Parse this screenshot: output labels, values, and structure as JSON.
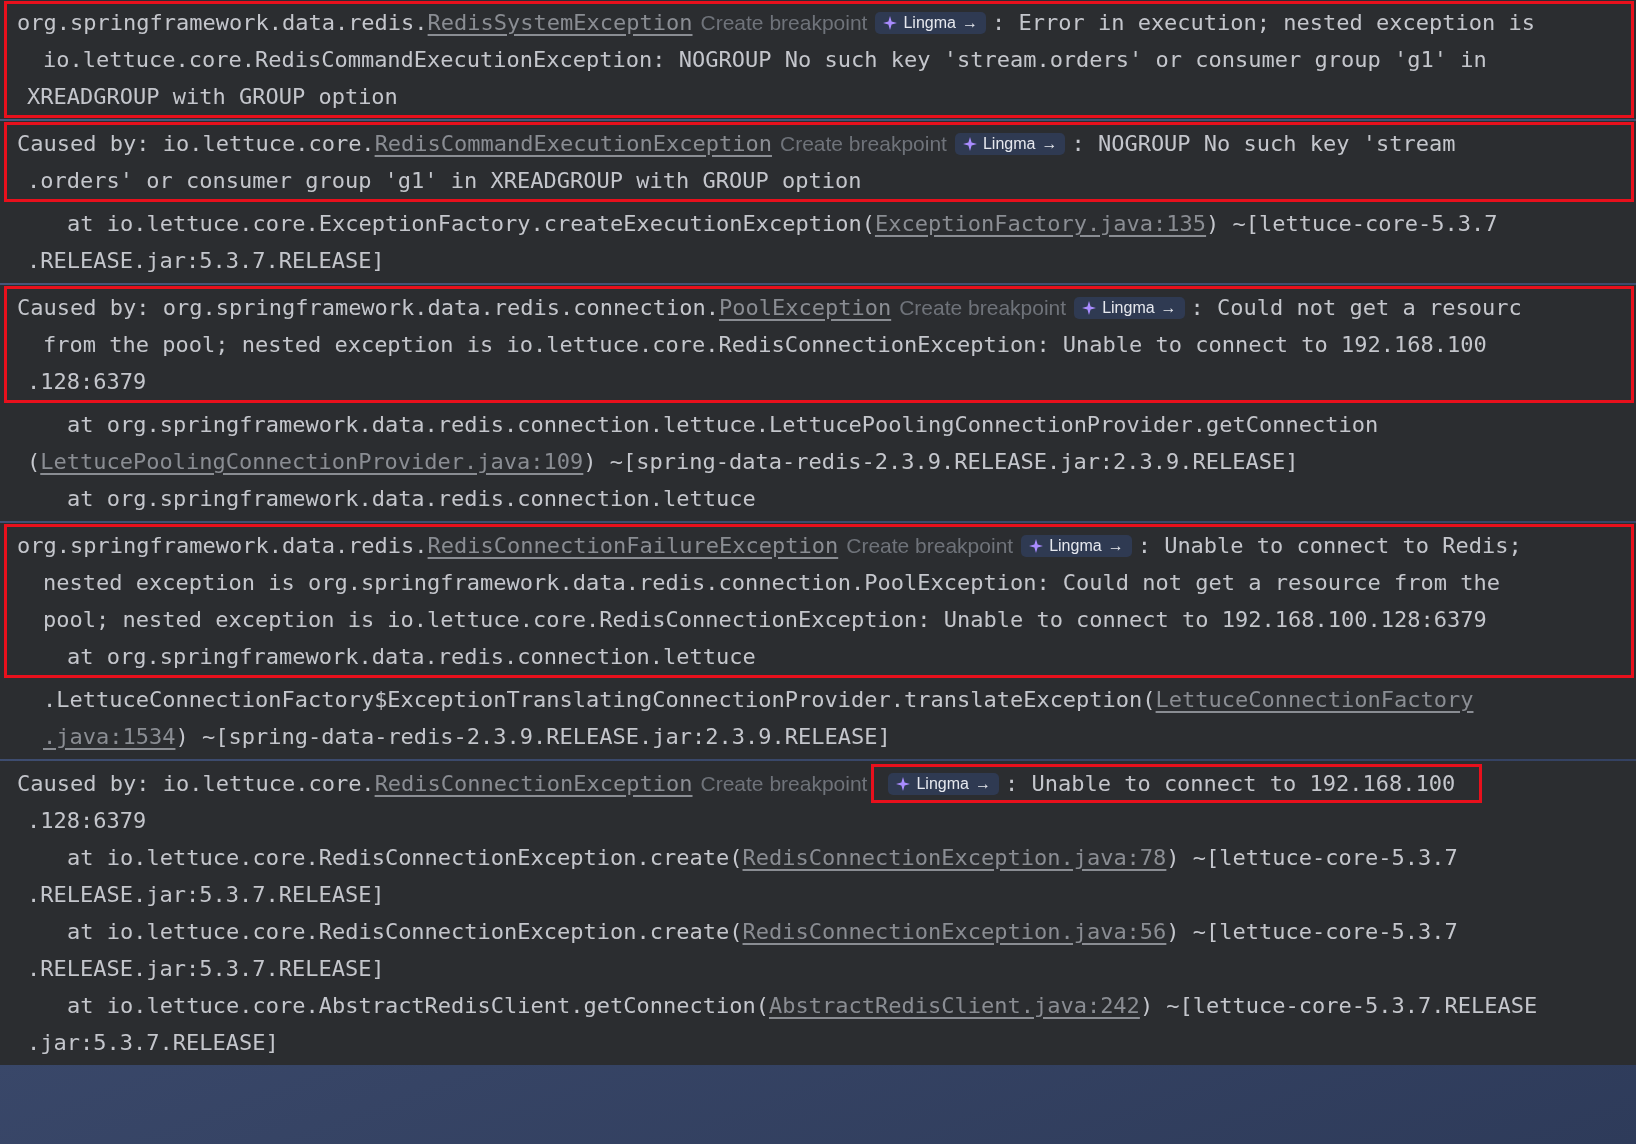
{
  "panels": [
    {
      "blocks": [
        {
          "highlighted": true,
          "lines": [
            {
              "kind": "head",
              "segments": [
                {
                  "kind": "text",
                  "text": "org.springframework.data.redis."
                },
                {
                  "kind": "link",
                  "text": "RedisSystemException"
                },
                {
                  "kind": "hint",
                  "text": "Create breakpoint"
                },
                {
                  "kind": "badge",
                  "text": "Lingma",
                  "arrow": "→"
                },
                {
                  "kind": "text",
                  "text": ": Error in execution; nested exception is"
                }
              ]
            },
            {
              "kind": "cont",
              "segments": [
                {
                  "kind": "text",
                  "text": "io.lettuce.core.RedisCommandExecutionException: NOGROUP No such key 'stream.orders' or consumer group 'g1' in"
                }
              ]
            },
            {
              "kind": "wrap",
              "segments": [
                {
                  "kind": "text",
                  "text": "XREADGROUP with GROUP option"
                }
              ]
            }
          ]
        }
      ]
    },
    {
      "blocks": [
        {
          "highlighted": true,
          "lines": [
            {
              "kind": "head",
              "segments": [
                {
                  "kind": "text",
                  "text": "Caused by: io.lettuce.core."
                },
                {
                  "kind": "link",
                  "text": "RedisCommandExecutionException"
                },
                {
                  "kind": "hint",
                  "text": "Create breakpoint"
                },
                {
                  "kind": "badge",
                  "text": "Lingma",
                  "arrow": "→"
                },
                {
                  "kind": "text",
                  "text": ": NOGROUP No such key 'stream"
                }
              ]
            },
            {
              "kind": "wrap",
              "segments": [
                {
                  "kind": "text",
                  "text": ".orders' or consumer group 'g1' in XREADGROUP with GROUP option"
                }
              ]
            }
          ]
        },
        {
          "highlighted": false,
          "lines": [
            {
              "kind": "frame",
              "segments": [
                {
                  "kind": "text",
                  "text": "at io.lettuce.core.ExceptionFactory.createExecutionException("
                },
                {
                  "kind": "link",
                  "text": "ExceptionFactory.java:135"
                },
                {
                  "kind": "text",
                  "text": ") ~[lettuce-core-5.3.7"
                }
              ]
            },
            {
              "kind": "wrap",
              "segments": [
                {
                  "kind": "text",
                  "text": ".RELEASE.jar:5.3.7.RELEASE]"
                }
              ]
            }
          ]
        }
      ]
    },
    {
      "blocks": [
        {
          "highlighted": true,
          "lines": [
            {
              "kind": "head",
              "segments": [
                {
                  "kind": "text",
                  "text": "Caused by: org.springframework.data.redis.connection."
                },
                {
                  "kind": "link",
                  "text": "PoolException"
                },
                {
                  "kind": "hint",
                  "text": "Create breakpoint"
                },
                {
                  "kind": "badge",
                  "text": "Lingma",
                  "arrow": "→"
                },
                {
                  "kind": "text",
                  "text": ": Could not get a resourc"
                }
              ]
            },
            {
              "kind": "cont",
              "segments": [
                {
                  "kind": "text",
                  "text": "from the pool; nested exception is io.lettuce.core.RedisConnectionException: Unable to connect to 192.168.100"
                }
              ]
            },
            {
              "kind": "wrap",
              "segments": [
                {
                  "kind": "text",
                  "text": ".128:6379"
                }
              ]
            }
          ]
        },
        {
          "highlighted": false,
          "lines": [
            {
              "kind": "frame",
              "segments": [
                {
                  "kind": "text",
                  "text": "at org.springframework.data.redis.connection.lettuce.LettucePoolingConnectionProvider.getConnection"
                }
              ]
            },
            {
              "kind": "wrap",
              "segments": [
                {
                  "kind": "text",
                  "text": "("
                },
                {
                  "kind": "link",
                  "text": "LettucePoolingConnectionProvider.java:109"
                },
                {
                  "kind": "text",
                  "text": ") ~[spring-data-redis-2.3.9.RELEASE.jar:2.3.9.RELEASE]"
                }
              ]
            },
            {
              "kind": "frame",
              "segments": [
                {
                  "kind": "text",
                  "text": "at org.springframework.data.redis.connection.lettuce"
                }
              ]
            }
          ]
        }
      ]
    },
    {
      "blocks": [
        {
          "highlighted": true,
          "lines": [
            {
              "kind": "head",
              "segments": [
                {
                  "kind": "text",
                  "text": "org.springframework.data.redis."
                },
                {
                  "kind": "link",
                  "text": "RedisConnectionFailureException"
                },
                {
                  "kind": "hint",
                  "text": "Create breakpoint"
                },
                {
                  "kind": "badge",
                  "text": "Lingma",
                  "arrow": "→"
                },
                {
                  "kind": "text",
                  "text": ": Unable to connect to Redis;"
                }
              ]
            },
            {
              "kind": "cont",
              "segments": [
                {
                  "kind": "text",
                  "text": "nested exception is org.springframework.data.redis.connection.PoolException: Could not get a resource from the"
                }
              ]
            },
            {
              "kind": "cont",
              "segments": [
                {
                  "kind": "text",
                  "text": "pool; nested exception is io.lettuce.core.RedisConnectionException: Unable to connect to 192.168.100.128:6379"
                }
              ]
            },
            {
              "kind": "frame",
              "segments": [
                {
                  "kind": "text",
                  "text": "at org.springframework.data.redis.connection.lettuce"
                }
              ]
            }
          ]
        },
        {
          "highlighted": false,
          "lines": [
            {
              "kind": "cont",
              "segments": [
                {
                  "kind": "text",
                  "text": ".LettuceConnectionFactory$ExceptionTranslatingConnectionProvider.translateException("
                },
                {
                  "kind": "link",
                  "text": "LettuceConnectionFactory"
                }
              ]
            },
            {
              "kind": "cont",
              "segments": [
                {
                  "kind": "link",
                  "text": ".java:1534"
                },
                {
                  "kind": "text",
                  "text": ") ~[spring-data-redis-2.3.9.RELEASE.jar:2.3.9.RELEASE]"
                }
              ]
            }
          ]
        }
      ]
    },
    {
      "blocks": [
        {
          "highlighted": false,
          "lines": [
            {
              "kind": "head",
              "segments": [
                {
                  "kind": "text",
                  "text": "Caused by: io.lettuce.core."
                },
                {
                  "kind": "link",
                  "text": "RedisConnectionException"
                },
                {
                  "kind": "hint",
                  "text": "Create breakpoint"
                },
                {
                  "kind": "box",
                  "segments": [
                    {
                      "kind": "badge",
                      "text": "Lingma",
                      "arrow": "→"
                    },
                    {
                      "kind": "text",
                      "text": ": Unable to connect to 192.168.100"
                    }
                  ]
                }
              ]
            },
            {
              "kind": "wrap",
              "segments": [
                {
                  "kind": "text",
                  "text": ".128:6379"
                }
              ]
            },
            {
              "kind": "frame",
              "segments": [
                {
                  "kind": "text",
                  "text": "at io.lettuce.core.RedisConnectionException.create("
                },
                {
                  "kind": "link",
                  "text": "RedisConnectionException.java:78"
                },
                {
                  "kind": "text",
                  "text": ") ~[lettuce-core-5.3.7"
                }
              ]
            },
            {
              "kind": "wrap",
              "segments": [
                {
                  "kind": "text",
                  "text": ".RELEASE.jar:5.3.7.RELEASE]"
                }
              ]
            },
            {
              "kind": "frame",
              "segments": [
                {
                  "kind": "text",
                  "text": "at io.lettuce.core.RedisConnectionException.create("
                },
                {
                  "kind": "link",
                  "text": "RedisConnectionException.java:56"
                },
                {
                  "kind": "text",
                  "text": ") ~[lettuce-core-5.3.7"
                }
              ]
            },
            {
              "kind": "wrap",
              "segments": [
                {
                  "kind": "text",
                  "text": ".RELEASE.jar:5.3.7.RELEASE]"
                }
              ]
            },
            {
              "kind": "frame",
              "segments": [
                {
                  "kind": "text",
                  "text": "at io.lettuce.core.AbstractRedisClient.getConnection("
                },
                {
                  "kind": "link",
                  "text": "AbstractRedisClient.java:242"
                },
                {
                  "kind": "text",
                  "text": ") ~[lettuce-core-5.3.7.RELEASE"
                }
              ]
            },
            {
              "kind": "wrap",
              "segments": [
                {
                  "kind": "text",
                  "text": ".jar:5.3.7.RELEASE]"
                }
              ]
            }
          ]
        }
      ]
    }
  ]
}
